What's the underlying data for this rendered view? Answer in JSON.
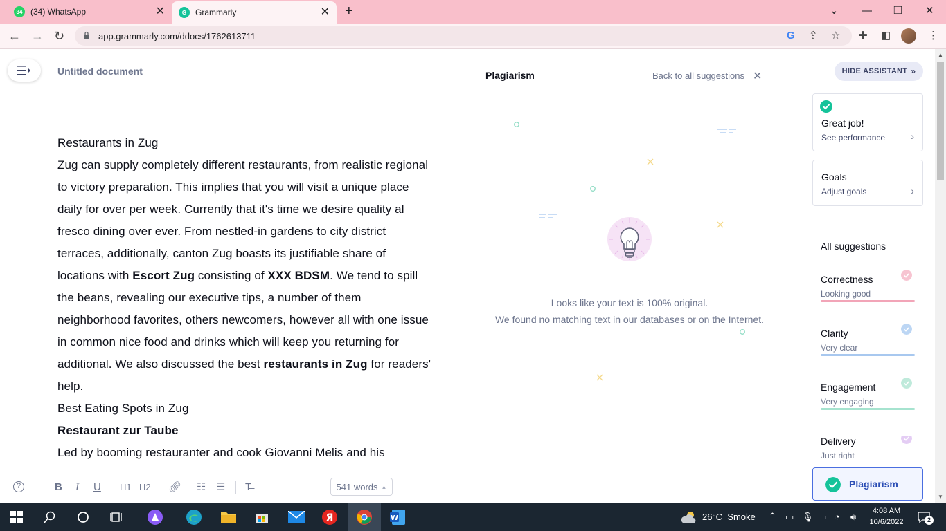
{
  "browser": {
    "tabs": [
      {
        "label": "(34) WhatsApp",
        "badge": "34"
      },
      {
        "label": "Grammarly"
      }
    ],
    "url": "app.grammarly.com/ddocs/1762613711"
  },
  "editor": {
    "title": "Untitled document",
    "word_count": "541 words",
    "format_tools": [
      "B",
      "I",
      "U",
      "H1",
      "H2"
    ]
  },
  "doc": {
    "p1": "Restaurants in Zug",
    "p2a": "Zug can supply completely different restaurants, from realistic regional to victory preparation. This implies that you will visit a unique place daily for over per week. Currently that it's time we desire quality al fresco dining over ever. From nestled-in gardens to city district terraces, additionally, canton Zug boasts its justifiable share of locations with ",
    "p2b": "Escort Zug",
    "p2c": " consisting of ",
    "p2d": "XXX BDSM",
    "p2e": ". We tend to spill the beans, revealing our executive tips, a number of them neighborhood favorites, others newcomers, however all with one issue in common nice food and drinks which will keep you returning for additional. We also discussed the best ",
    "p2f": "restaurants in Zug",
    "p2g": " for readers' help.",
    "p3": "Best Eating Spots in Zug",
    "p4": "Restaurant zur Taube",
    "p5": "Led by booming restauranter and cook Giovanni Melis and his"
  },
  "plagiarism": {
    "title": "Plagiarism",
    "back": "Back to all suggestions",
    "msg1": "Looks like your text is 100% original.",
    "msg2": "We found no matching text in our databases or on the Internet."
  },
  "assistant": {
    "hide": "HIDE ASSISTANT",
    "great_title": "Great job!",
    "great_sub": "See performance",
    "goals_title": "Goals",
    "goals_sub": "Adjust goals",
    "all": "All suggestions",
    "categories": [
      {
        "name": "Correctness",
        "desc": "Looking good",
        "color": "#f2a5b8"
      },
      {
        "name": "Clarity",
        "desc": "Very clear",
        "color": "#a8c8ef"
      },
      {
        "name": "Engagement",
        "desc": "Very engaging",
        "color": "#a6e3cf"
      },
      {
        "name": "Delivery",
        "desc": "Just right",
        "color": "#d9b8f0"
      }
    ],
    "plag_btn": "Plagiarism"
  },
  "taskbar": {
    "weather": "26°C  Smoke",
    "time": "4:08 AM",
    "date": "10/6/2022",
    "notif": "2"
  }
}
